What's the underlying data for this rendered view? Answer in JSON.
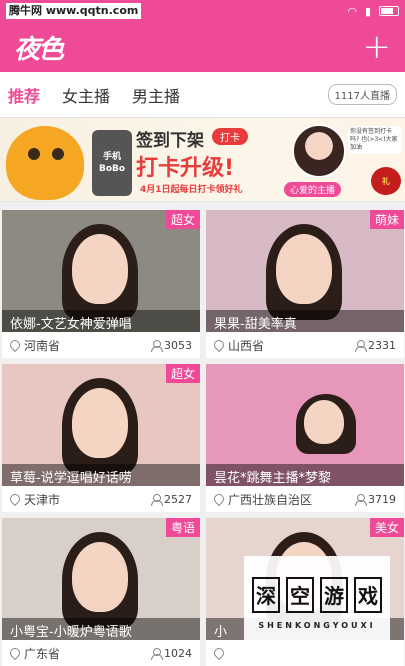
{
  "statusbar": {
    "watermark": "腾牛网 www.qqtn.com",
    "time": "",
    "icons": [
      "wifi-icon",
      "signal-icon",
      "battery-icon"
    ]
  },
  "appbar": {
    "logo": "夜色",
    "add_label": "+"
  },
  "tabs": [
    {
      "label": "推荐",
      "active": true
    },
    {
      "label": "女主播",
      "active": false
    },
    {
      "label": "男主播",
      "active": false
    }
  ],
  "live_count": "1117人直播",
  "banner": {
    "phone_line1": "手机",
    "phone_line2": "BoBo",
    "title1": "签到下架",
    "button": "打卡",
    "title2": "打卡升级!",
    "sub": "4月1日起每日打卡领好礼",
    "fav": "心爱的主播",
    "bubble": "你没有签到打卡吗? 也(>3<)大家加油"
  },
  "cards": [
    {
      "tag": "超女",
      "title": "依娜-文艺女神爱弹唱",
      "location": "河南省",
      "viewers": "3053",
      "bg": "#8d8a82"
    },
    {
      "tag": "萌妹",
      "title": "果果-甜美率真",
      "location": "山西省",
      "viewers": "2331",
      "bg": "#d6b9c4"
    },
    {
      "tag": "超女",
      "title": "草莓-说学逗唱好话唠",
      "location": "天津市",
      "viewers": "2527",
      "bg": "#e8c7c3"
    },
    {
      "tag": "",
      "title": "昙花*跳舞主播*梦黎",
      "location": "广西壮族自治区",
      "viewers": "3719",
      "bg": "#e797b9"
    },
    {
      "tag": "粤语",
      "title": "小粤宝-小暖炉粤语歌",
      "location": "广东省",
      "viewers": "1024",
      "bg": "#d9cfc9"
    },
    {
      "tag": "美女",
      "title": "小",
      "location": "",
      "viewers": "",
      "bg": "#e6d5cf"
    }
  ],
  "brand": {
    "chars": [
      "深",
      "空",
      "游",
      "戏"
    ],
    "sub": "SHENKONGYOUXI"
  },
  "colors": {
    "accent": "#ee4a97"
  }
}
